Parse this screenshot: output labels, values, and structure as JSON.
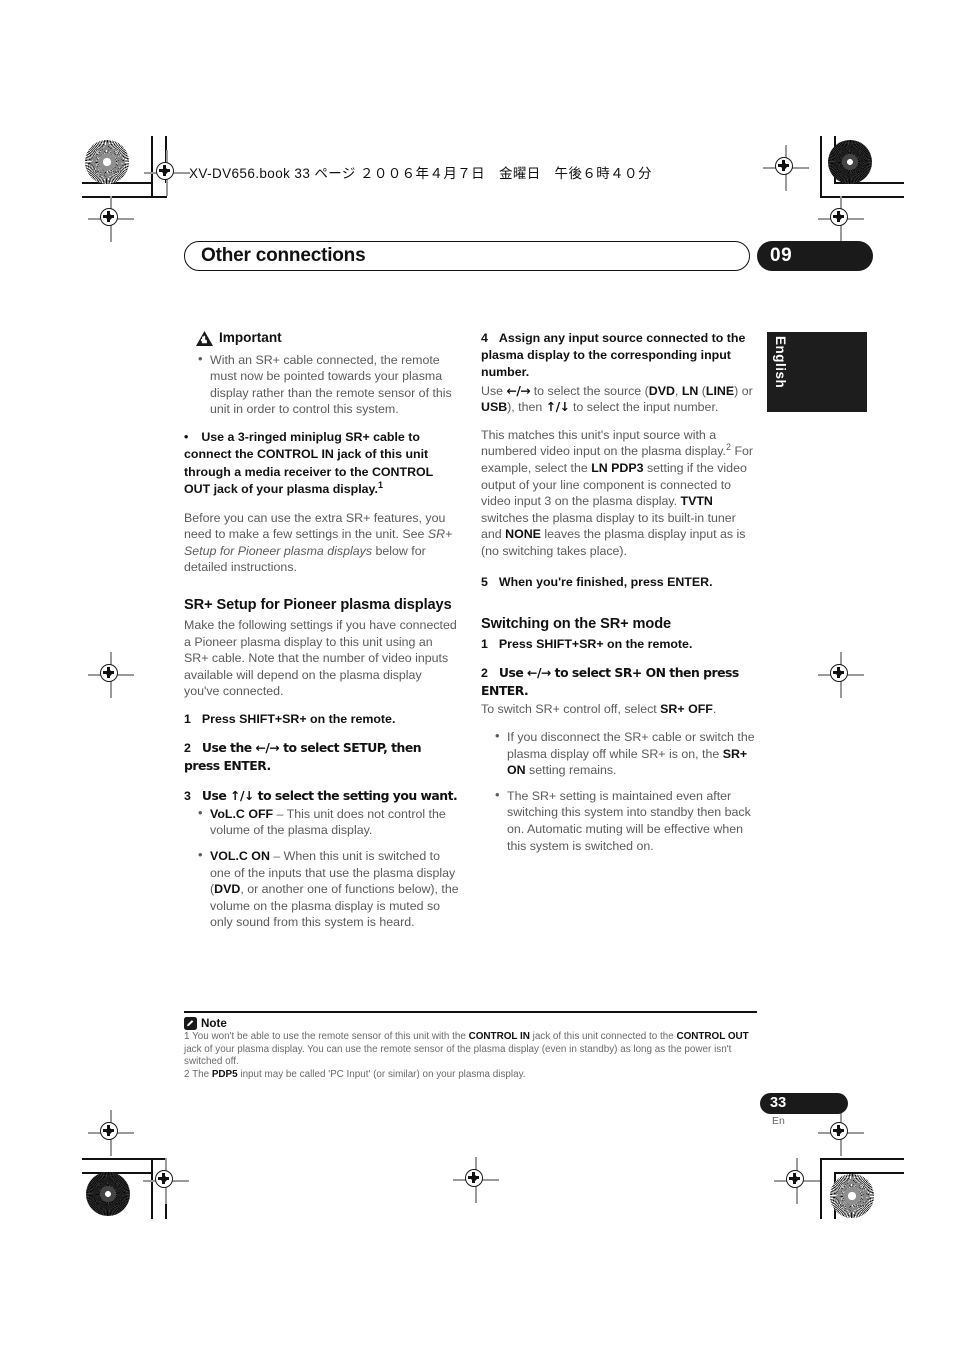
{
  "header": {
    "book_line": "XV-DV656.book  33 ページ  ２００６年４月７日　金曜日　午後６時４０分",
    "chapter_title": "Other connections",
    "chapter_number": "09",
    "language_tab": "English"
  },
  "left_column": {
    "important_label": "Important",
    "important_bullet": "With an SR+ cable connected, the remote must now be pointed towards your plasma display rather than the remote sensor of this unit in order to control this system.",
    "bold_bullet": {
      "bold_part": "Use a 3-ringed miniplug SR+ cable to connect the CONTROL IN jack of this unit through a media receiver to the CONTROL OUT jack of your plasma display.",
      "footnote_ref": "1",
      "follow_text_1": "Before you can use the extra SR+ features, you need to make a few settings in the unit. See ",
      "follow_italic": "SR+ Setup for Pioneer plasma displays",
      "follow_text_2": " below for detailed instructions."
    },
    "section_heading": "SR+ Setup for Pioneer plasma displays",
    "section_intro": "Make the following settings if you have connected a Pioneer plasma display to this unit using an SR+ cable. Note that the number of video inputs available will depend on the plasma display you've connected.",
    "steps": [
      {
        "n": "1",
        "text": "Press SHIFT+SR+ on the remote."
      },
      {
        "n": "2",
        "text": "Use the ←/→ to select SETUP, then press ENTER."
      },
      {
        "n": "3",
        "text": "Use ↑/↓ to select the setting you want."
      }
    ],
    "setting_bullets": [
      {
        "bold": "VoL.C OFF",
        "rest": " – This unit does not control the volume of the plasma display."
      },
      {
        "bold": "VOL.C ON",
        "rest_a": " – When this unit is switched to one of the inputs that use the plasma display (",
        "inline_bold": "DVD",
        "rest_b": ", or another one of functions below), the volume on the plasma display is muted so only sound from this system is heard."
      }
    ]
  },
  "right_column": {
    "step4": {
      "n": "4",
      "title": "Assign any input source connected to the plasma display to the corresponding input number.",
      "body_1": "Use ",
      "arrows_lr": "←/→",
      "body_2": " to select the source (",
      "b_dvd": "DVD",
      "body_3": ", ",
      "b_ln": "LN",
      "body_4": " (",
      "b_line": "LINE",
      "body_5": ") or ",
      "b_usb": "USB",
      "body_6": "), then ",
      "arrows_ud": "↑/↓",
      "body_7": " to select the input number.",
      "para2_a": "This matches this unit's input source with a numbered video input on the plasma display.",
      "para2_ref": "2",
      "para2_b": " For example, select the ",
      "b_lnpdp3": "LN PDP3",
      "para2_c": " setting if the video output of your line component is connected to video input 3 on the plasma display. ",
      "b_tvtn": "TVTN",
      "para2_d": " switches the plasma display to its built-in tuner and ",
      "b_none": "NONE",
      "para2_e": " leaves the plasma display input as is (no switching takes place)."
    },
    "step5": {
      "n": "5",
      "text": "When you're finished, press ENTER."
    },
    "section_heading": "Switching on the SR+ mode",
    "steps": [
      {
        "n": "1",
        "text": "Press SHIFT+SR+ on the remote."
      },
      {
        "n": "2",
        "text": "Use ←/→ to select SR+ ON then press ENTER."
      }
    ],
    "step2_follow_a": "To switch SR+ control off, select ",
    "step2_follow_bold": "SR+ OFF",
    "step2_follow_b": ".",
    "notes_bullets": [
      {
        "text_a": "If you disconnect the SR+ cable or switch the plasma display off while SR+ is on, the ",
        "bold": "SR+ ON",
        "text_b": " setting remains."
      },
      {
        "text_a": "The SR+ setting is maintained even after switching this system into standby then back on. Automatic muting will be effective when this system is switched on.",
        "bold": "",
        "text_b": ""
      }
    ]
  },
  "footer": {
    "note_label": "Note",
    "footnote_1": {
      "num": "1",
      "a": " You won't be able to use the remote sensor of this unit with the ",
      "b1": "CONTROL IN",
      "b": " jack of this unit connected to the ",
      "b2": "CONTROL OUT",
      "c": " jack of your plasma display. You can use the remote sensor of the plasma display (even in standby) as long as the power isn't switched off."
    },
    "footnote_2": {
      "num": "2",
      "a": " The ",
      "b1": "PDP5",
      "b": " input may be called 'PC Input' (or similar) on your plasma display."
    },
    "page_number": "33",
    "page_lang": "En"
  },
  "colors": {
    "ink_black": "#1a1a1a",
    "body_gray": "#5b5b5b",
    "reg_gray": "#9a9a9a"
  }
}
